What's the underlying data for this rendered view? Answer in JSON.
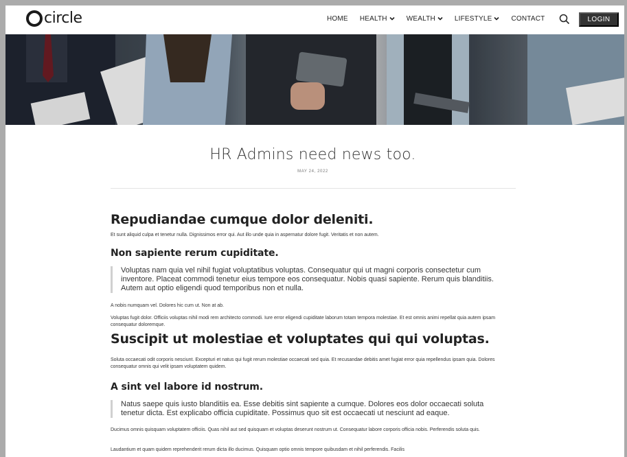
{
  "header": {
    "logo_text": "circle",
    "nav": [
      {
        "label": "HOME",
        "dropdown": false
      },
      {
        "label": "HEALTH",
        "dropdown": true
      },
      {
        "label": "WEALTH",
        "dropdown": true
      },
      {
        "label": "LIFESTYLE",
        "dropdown": true
      },
      {
        "label": "CONTACT",
        "dropdown": false
      }
    ],
    "search_icon": "search-icon",
    "login_label": "LOGIN"
  },
  "colors": {
    "login_bg": "#333333",
    "hero_bg": "#2b3138",
    "frame": "#ababab"
  },
  "post": {
    "title": "HR Admins need news too.",
    "date": "MAY 24, 2022"
  },
  "content": {
    "h1_a": "Repudiandae cumque dolor deleniti.",
    "p_a": "Et sunt aliquid culpa et tenetur nulla. Dignissimos error qui. Aut illo unde quia in aspernatur dolore fugit. Veritatis et non autem.",
    "h2_a": "Non sapiente rerum cupiditate.",
    "quote_a": "Voluptas nam quia vel nihil fugiat voluptatibus voluptas. Consequatur qui ut magni corporis consectetur cum inventore. Placeat commodi tenetur eius tempore eos consequatur. Nobis quasi sapiente. Rerum quis blanditiis. Autem aut optio eligendi quod temporibus non et nulla.",
    "p_b": "A nobis numquam vel. Dolores hic cum ut. Non at ab.",
    "p_c": "Voluptas fugit dolor. Officiis voluptas nihil modi rem architecto commodi. Iure error eligendi cupiditate laborum totam tempora molestiae. Et est omnis animi repellat quia autem ipsam consequatur doloremque.",
    "h1_b": "Suscipit ut molestiae et voluptates qui qui voluptas.",
    "p_d": "Soluta occaecati odit corporis nesciunt. Excepturi et natus qui fugit rerum molestiae occaecati sed quia. Et recusandae debitis amet fugiat error quia repellendus ipsam quia. Dolores consequatur omnis qui velit ipsam voluptatem quidem.",
    "h2_b": "A sint vel labore id nostrum.",
    "quote_b": "Natus saepe quis iusto blanditiis ea. Esse debitis sint sapiente a cumque. Dolores eos dolor occaecati soluta tenetur dicta. Est explicabo officia cupiditate. Possimus quo sit est occaecati ut nesciunt ad eaque.",
    "p_e": "Ducimus omnis quisquam voluptatem officiis. Quas nihil aut sed quisquam et voluptas deserunt nostrum ut. Consequatur labore corporis officia nobis. Perferendis soluta quis.",
    "p_f": "Laudantium et quam quidem reprehenderit rerum dicta illo ducimus. Quisquam optio omnis tempore quibusdam et nihil perferendis. Facilis"
  }
}
